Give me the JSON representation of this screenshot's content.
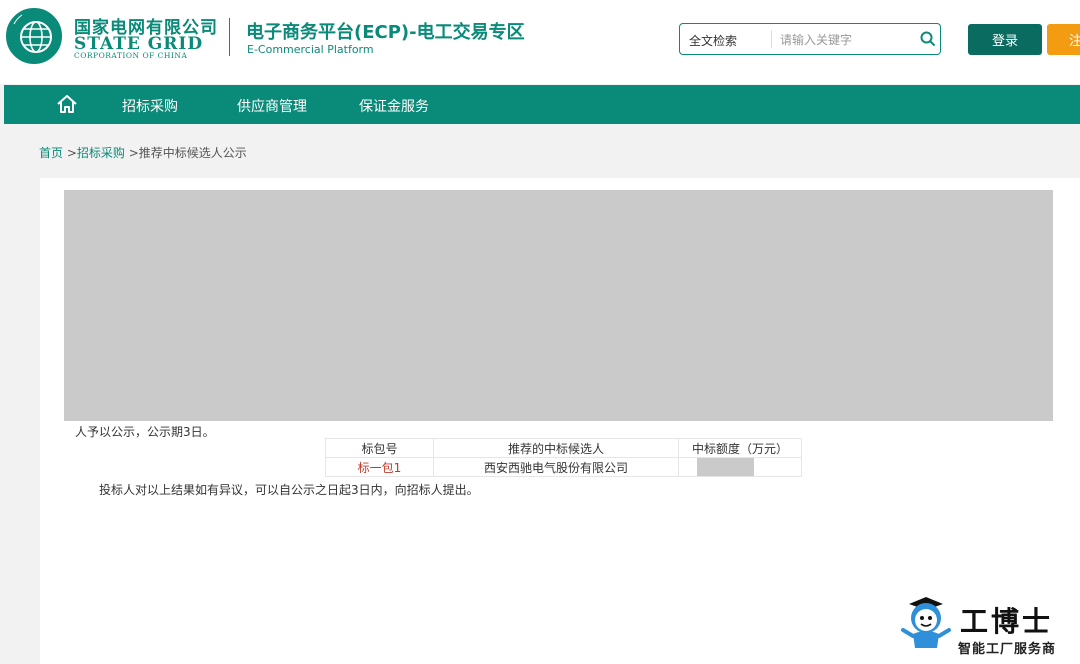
{
  "header": {
    "company_cn": "国家电网有限公司",
    "company_en": "STATE GRID",
    "company_en_sub": "CORPORATION OF CHINA",
    "platform_title": "电子商务平台(ECP)-电工交易专区",
    "platform_sub": "E-Commercial Platform",
    "search": {
      "type_label": "全文检索",
      "placeholder": "请输入关键字",
      "value": ""
    },
    "login_label": "登录",
    "register_label": "注",
    "brand_color": "#0a8a78"
  },
  "nav": {
    "home_icon": "home-icon",
    "items": [
      {
        "label": "招标采购"
      },
      {
        "label": "供应商管理"
      },
      {
        "label": "保证金服务"
      }
    ]
  },
  "breadcrumb": {
    "home": "首页",
    "sep1": " >",
    "section": "招标采购",
    "sep2": " >",
    "current": "推荐中标候选人公示"
  },
  "notice": {
    "intro_tail": "人予以公示，公示期3日。",
    "table": {
      "headers": [
        "标包号",
        "推荐的中标候选人",
        "中标额度（万元）"
      ],
      "rows": [
        {
          "package": "标一包1",
          "candidate": "西安西驰电气股份有限公司",
          "amount": ""
        }
      ]
    },
    "objection": "投标人对以上结果如有异议，可以自公示之日起3日内，向招标人提出。"
  },
  "watermark": {
    "title": "工博士",
    "subtitle": "智能工厂服务商"
  }
}
